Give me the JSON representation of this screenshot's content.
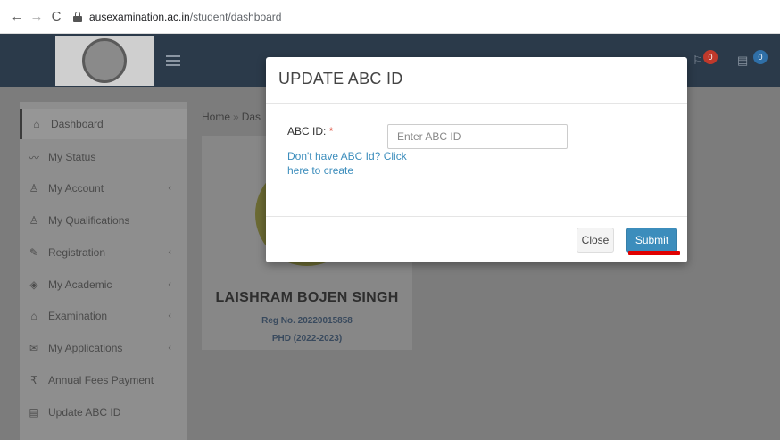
{
  "browser": {
    "back_icon": "←",
    "forward_icon": "→",
    "reload_icon": "C",
    "url_domain": "ausexamination.ac.in",
    "url_path": "/student/dashboard"
  },
  "header": {
    "badges": [
      "0",
      "0"
    ],
    "badge_colors": [
      "#c0392b",
      "#2f6fa7"
    ]
  },
  "sidebar": {
    "items": [
      {
        "label": "Dashboard",
        "icon": "⌂",
        "chevron": ""
      },
      {
        "label": "My Status",
        "icon": "〰",
        "chevron": ""
      },
      {
        "label": "My Account",
        "icon": "♙",
        "chevron": "‹"
      },
      {
        "label": "My Qualifications",
        "icon": "♙",
        "chevron": ""
      },
      {
        "label": "Registration",
        "icon": "✎",
        "chevron": "‹"
      },
      {
        "label": "My Academic",
        "icon": "◈",
        "chevron": "‹"
      },
      {
        "label": "Examination",
        "icon": "⌂",
        "chevron": "‹"
      },
      {
        "label": "My Applications",
        "icon": "✉",
        "chevron": "‹"
      },
      {
        "label": "Annual Fees Payment",
        "icon": "₹",
        "chevron": ""
      },
      {
        "label": "Update ABC ID",
        "icon": "▤",
        "chevron": ""
      }
    ]
  },
  "breadcrumb": {
    "home": "Home",
    "separator": "»",
    "current": "Das"
  },
  "profile": {
    "name": "LAISHRAM BOJEN SINGH",
    "reg_no": "Reg No. 20220015858",
    "program": "PHD (2022-2023)"
  },
  "modal": {
    "title": "UPDATE ABC ID",
    "field_label": "ABC ID:",
    "required_mark": "*",
    "input_placeholder": "Enter ABC ID",
    "input_value": "",
    "create_link": "Don't have ABC Id? Click here to create",
    "close_label": "Close",
    "submit_label": "Submit"
  },
  "colors": {
    "accent": "#3c8dbc",
    "annotation": "#e00000"
  }
}
